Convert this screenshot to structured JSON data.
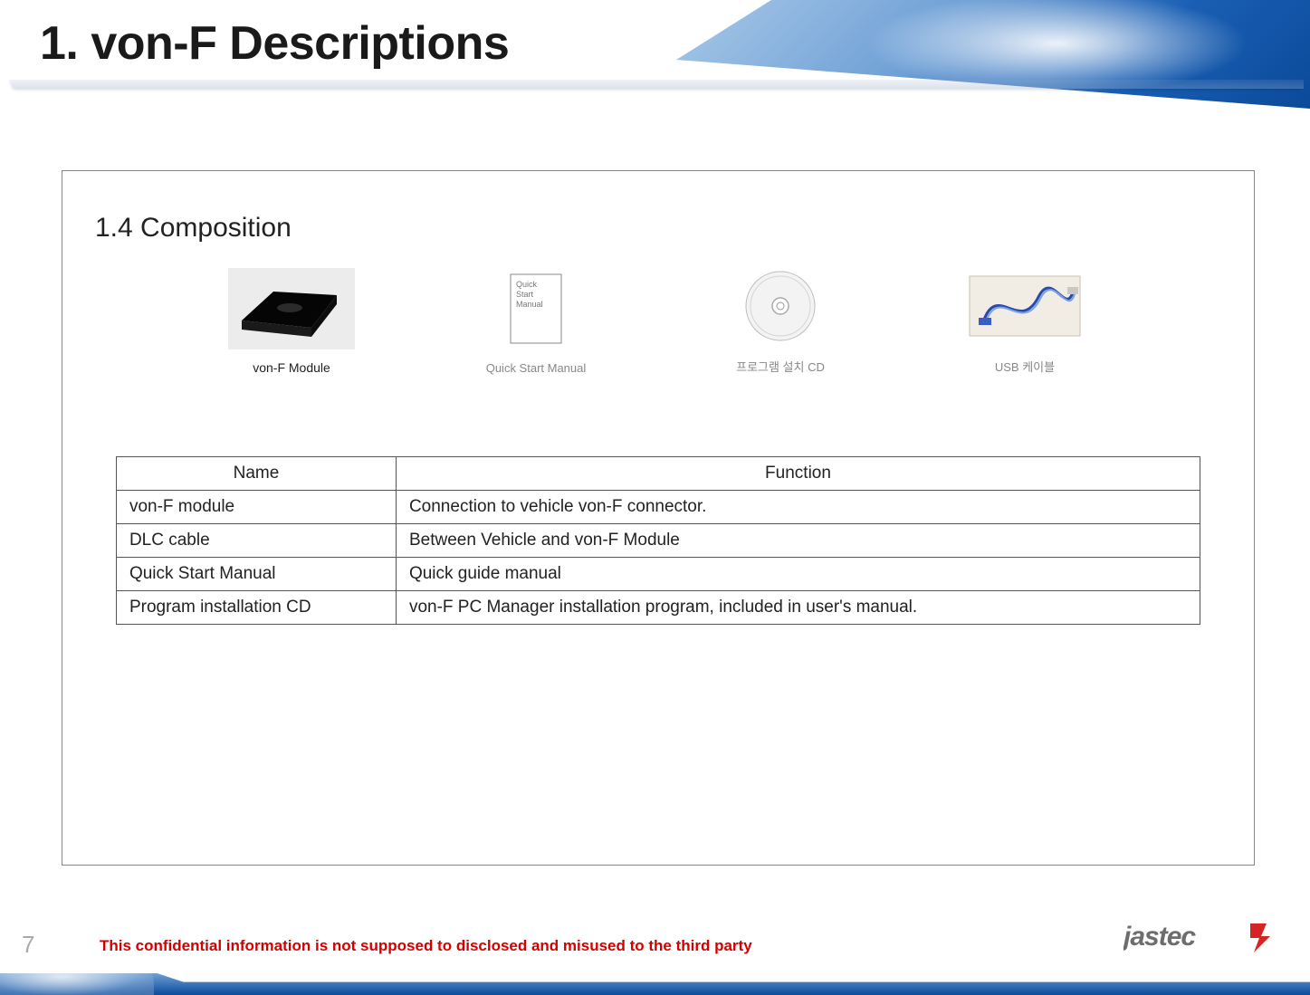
{
  "header": {
    "title": "1. von-F Descriptions"
  },
  "section": {
    "title": "1.4 Composition"
  },
  "components": [
    {
      "label": "von-F Module"
    },
    {
      "label": "Quick Start Manual",
      "box_text": "Quick\nStart\nManual"
    },
    {
      "label": "프로그램 설치 CD"
    },
    {
      "label": "USB 케이블"
    }
  ],
  "table": {
    "headers": {
      "name": "Name",
      "function": "Function"
    },
    "rows": [
      {
        "name": "von-F module",
        "function": "Connection to vehicle von-F connector."
      },
      {
        "name": "DLC cable",
        "function": "Between Vehicle and von-F Module"
      },
      {
        "name": "Quick Start Manual",
        "function": "Quick guide manual"
      },
      {
        "name": "Program installation CD",
        "function": "von-F PC Manager  installation program,  included in user's manual."
      }
    ]
  },
  "footer": {
    "page_number": "7",
    "confidential": "This confidential information is not supposed to disclosed and misused to the third party",
    "logo_text": "jastec"
  }
}
